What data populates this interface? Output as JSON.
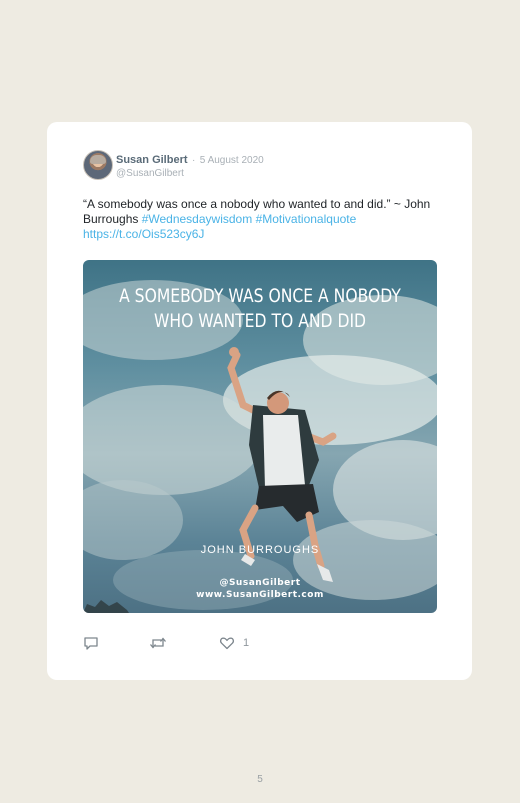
{
  "tweet": {
    "author_name": "Susan Gilbert",
    "separator": "·",
    "date": "5 August 2020",
    "handle": "@SusanGilbert",
    "text": "“A somebody was once a nobody who wanted to and did.” ~ John Burroughs ",
    "hashtag_1": "#Wednesdaywisdom",
    "hashtag_2": "#Motivationalquote",
    "link": "https://t.co/Ois523cy6J",
    "like_count": "1"
  },
  "image": {
    "title_line_1": "A SOMEBODY WAS ONCE A NOBODY",
    "title_line_2": "WHO WANTED TO AND DID",
    "author": "JOHN BURROUGHS",
    "handle": "@SusanGilbert",
    "url": "www.SusanGilbert.com"
  },
  "icons": {
    "reply": "reply-icon",
    "retweet": "retweet-icon",
    "like": "heart-icon"
  },
  "colors": {
    "background": "#eeebe2",
    "card": "#ffffff",
    "link": "#4ab3e6",
    "name": "#5a6b78"
  },
  "page": {
    "number": "5"
  }
}
